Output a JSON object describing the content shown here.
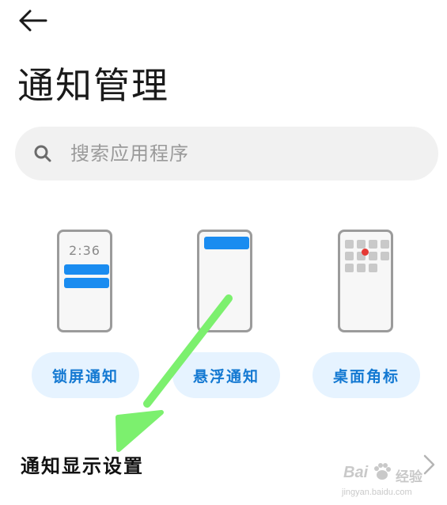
{
  "header": {
    "back_icon": "arrow-left-icon",
    "title": "通知管理"
  },
  "search": {
    "icon": "search-icon",
    "placeholder": "搜索应用程序"
  },
  "styles": [
    {
      "key": "lock",
      "preview_time": "2:36",
      "label": "锁屏通知"
    },
    {
      "key": "float",
      "label": "悬浮通知"
    },
    {
      "key": "badge",
      "label": "桌面角标"
    }
  ],
  "settings": {
    "display_settings_label": "通知显示设置",
    "chevron_icon": "chevron-right-icon"
  },
  "annotation": {
    "arrow_color": "#7cf06e"
  },
  "watermark": {
    "brand": "Bai",
    "site_name": "经验",
    "url": "jingyan.baidu.com"
  },
  "colors": {
    "accent_blue": "#1a8cf0",
    "pill_bg": "#e6f3ff",
    "pill_text": "#1479d2",
    "badge_red": "#e53935",
    "search_bg": "#f1f1f1"
  }
}
